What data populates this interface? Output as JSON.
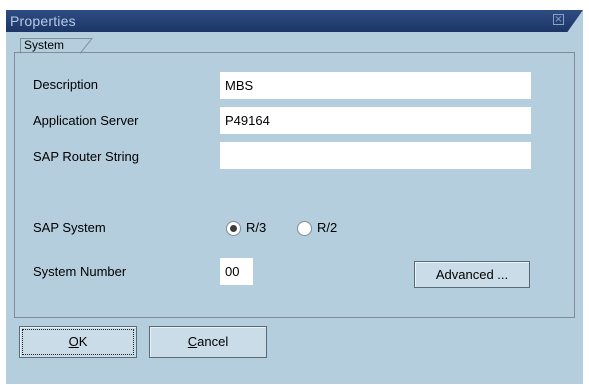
{
  "window": {
    "title": "Properties",
    "close_icon": "close-icon"
  },
  "group": {
    "tab_label": "System"
  },
  "fields": {
    "description": {
      "label": "Description",
      "value": "MBS"
    },
    "app_server": {
      "label": "Application Server",
      "value": "P49164"
    },
    "router": {
      "label": "SAP Router String",
      "value": ""
    },
    "sap_system": {
      "label": "SAP System",
      "options": [
        "R/3",
        "R/2"
      ],
      "selected": "R/3"
    },
    "system_number": {
      "label": "System Number",
      "value": "00"
    }
  },
  "buttons": {
    "advanced": "Advanced ...",
    "ok_mnemonic": "O",
    "ok_rest": "K",
    "cancel_mnemonic": "C",
    "cancel_rest": "ancel"
  },
  "colors": {
    "dialog_bg": "#b4cedd",
    "titlebar": "#1c3566",
    "button_bg": "#c9dce8"
  }
}
